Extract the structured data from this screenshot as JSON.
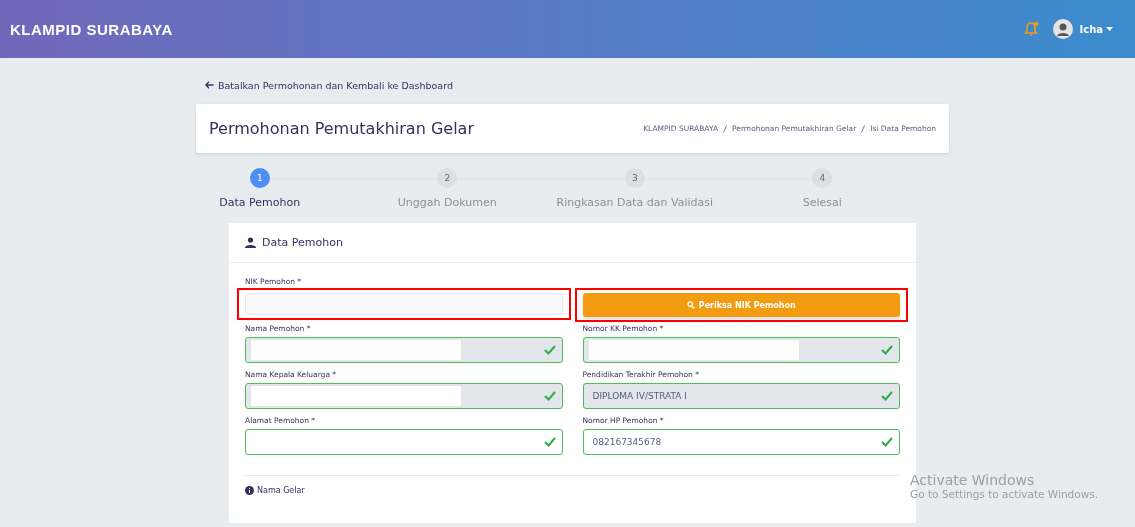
{
  "navbar": {
    "brand": "KLAMPID SURABAYA",
    "notification_dot": true,
    "user": "Icha"
  },
  "back_link": "Batalkan Permohonan dan Kembali ke Dashboard",
  "page_header": {
    "title": "Permohonan Pemutakhiran Gelar",
    "breadcrumb": [
      "KLAMPID SURABAYA",
      "Permohonan Pemutakhiran Gelar",
      "Isi Data Pemohon"
    ]
  },
  "steps": [
    {
      "number": "1",
      "label": "Data Pemohon",
      "selected": true
    },
    {
      "number": "2",
      "label": "Unggah Dokumen",
      "selected": false
    },
    {
      "number": "3",
      "label": "Ringkasan Data dan Validasi",
      "selected": false
    },
    {
      "number": "4",
      "label": "Selesai",
      "selected": false
    }
  ],
  "form": {
    "title": "Data Pemohon",
    "nik": {
      "label": "NIK Pemohon *",
      "highlighted": true
    },
    "check_button": {
      "label": "Periksa NIK Pemohon",
      "highlighted": true
    },
    "fields": [
      {
        "label": "Nama Pemohon *",
        "readonly": true,
        "redacted": true,
        "valid": true
      },
      {
        "label": "Nomor KK Pemohon *",
        "readonly": true,
        "redacted": true,
        "valid": true
      },
      {
        "label": "Nama Kepala Keluarga *",
        "readonly": true,
        "redacted": true,
        "valid": true
      },
      {
        "label": "Pendidikan Terakhir Pemohon *",
        "readonly": true,
        "valid": true,
        "value": "DIPLOMA IV/STRATA I"
      },
      {
        "label": "Alamat Pemohon *",
        "readonly": false,
        "valid": true
      },
      {
        "label": "Nomor HP Pemohon *",
        "readonly": false,
        "valid": true,
        "value": "082167345678"
      }
    ],
    "next_section": "Nama Gelar"
  },
  "os_notice": {
    "title": "Activate Windows",
    "text": "Go to Settings to activate Windows."
  }
}
